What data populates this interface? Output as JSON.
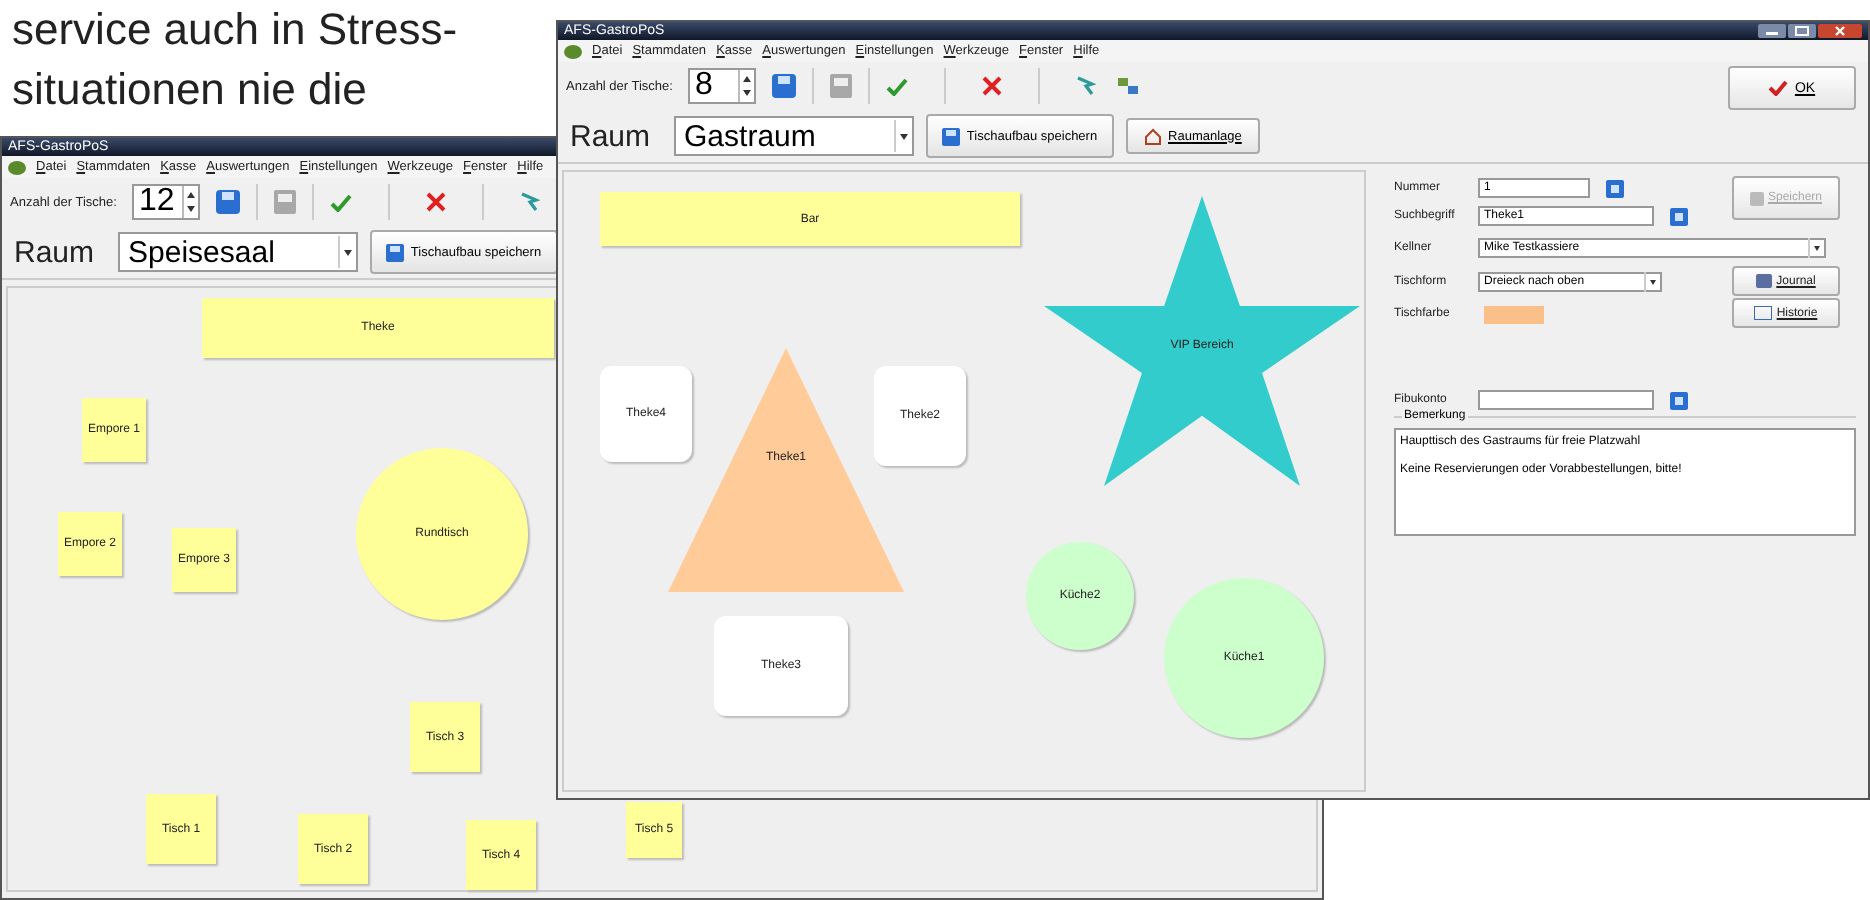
{
  "document_text": {
    "lines": [
      "service auch in Stress-",
      "situationen nie die"
    ]
  },
  "windows": [
    {
      "title": "AFS-GastroPoS",
      "menu": [
        "Datei",
        "Stammdaten",
        "Kasse",
        "Auswertungen",
        "Einstellungen",
        "Werkzeuge",
        "Fenster",
        "Hilfe"
      ],
      "table_count_label": "Anzahl der Tische:",
      "table_count": "12",
      "room_label": "Raum",
      "room": "Speisesaal",
      "buttons": [
        {
          "kind": "save",
          "label": "Tischaufbau speichern"
        }
      ],
      "tables": [
        {
          "label": "Theke",
          "kind": "rect",
          "color": "#ffff99"
        },
        {
          "label": "Empore 1",
          "kind": "rect",
          "color": "#ffff99"
        },
        {
          "label": "Empore 2",
          "kind": "rect",
          "color": "#ffff99"
        },
        {
          "label": "Empore 3",
          "kind": "rect",
          "color": "#ffff99"
        },
        {
          "label": "Rundtisch",
          "kind": "circle",
          "color": "#ffff99"
        },
        {
          "label": "Tisch 3",
          "kind": "rect",
          "color": "#ffff99"
        },
        {
          "label": "Tisch 1",
          "kind": "rect",
          "color": "#ffff99"
        },
        {
          "label": "Tisch 2",
          "kind": "rect",
          "color": "#ffff99"
        },
        {
          "label": "Tisch 4",
          "kind": "rect",
          "color": "#ffff99"
        },
        {
          "label": "Tisch 5",
          "kind": "rect",
          "color": "#ffff99"
        }
      ]
    },
    {
      "title": "AFS-GastroPoS",
      "menu": [
        "Datei",
        "Stammdaten",
        "Kasse",
        "Auswertungen",
        "Einstellungen",
        "Werkzeuge",
        "Fenster",
        "Hilfe"
      ],
      "table_count_label": "Anzahl der Tische:",
      "table_count": "8",
      "room_label": "Raum",
      "room": "Gastraum",
      "buttons": [
        {
          "kind": "save",
          "label": "Tischaufbau speichern"
        },
        {
          "kind": "room",
          "label": "Raumanlage"
        }
      ],
      "ok_button": "OK",
      "tables": [
        {
          "label": "Bar",
          "kind": "rect",
          "color": "#ffff99"
        },
        {
          "label": "VIP Bereich",
          "kind": "star",
          "color": "#33cccc"
        },
        {
          "label": "Theke4",
          "kind": "rounded",
          "color": "#ffffff"
        },
        {
          "label": "Theke1",
          "kind": "triangle",
          "color": "#ffcc99"
        },
        {
          "label": "Theke2",
          "kind": "rounded",
          "color": "#ffffff"
        },
        {
          "label": "Theke3",
          "kind": "rounded",
          "color": "#ffffff"
        },
        {
          "label": "Küche2",
          "kind": "circle",
          "color": "#ccffcc"
        },
        {
          "label": "Küche1",
          "kind": "circle",
          "color": "#ccffcc"
        }
      ],
      "details": {
        "fields": [
          {
            "label": "Nummer",
            "kind": "input",
            "value": "1",
            "lookup": true
          },
          {
            "label": "Suchbegriff",
            "kind": "input",
            "value": "Theke1",
            "lookup": true
          },
          {
            "label": "Kellner",
            "kind": "combo",
            "value": "Mike Testkassiere"
          },
          {
            "label": "Tischform",
            "kind": "combo",
            "value": "Dreieck nach oben"
          },
          {
            "label": "Tischfarbe",
            "kind": "color",
            "color": "#fbc08a"
          }
        ],
        "buttons": [
          {
            "label": "Speichern",
            "kind": "save",
            "disabled": true
          },
          {
            "label": "Journal",
            "kind": "journal",
            "disabled": false
          },
          {
            "label": "Historie",
            "kind": "history",
            "disabled": false
          }
        ],
        "account": {
          "label": "Fibukonto",
          "lookup": true
        },
        "remark": {
          "label": "Bemerkung",
          "lines": [
            "Haupttisch des Gastraums für freie Platzwahl",
            "Keine Reservierungen oder Vorabbestellungen, bitte!"
          ]
        }
      }
    }
  ]
}
